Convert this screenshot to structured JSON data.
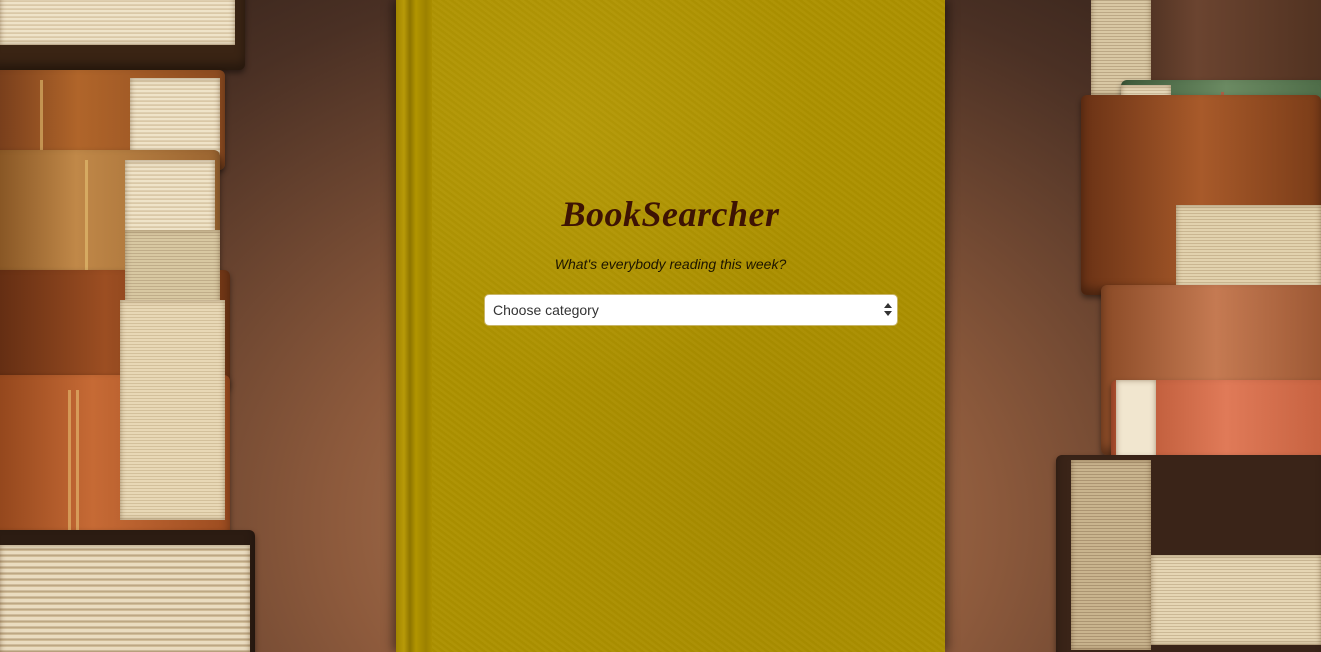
{
  "app": {
    "title": "BookSearcher",
    "subtitle": "What's everybody reading this week?"
  },
  "category_select": {
    "selected": "Choose category"
  },
  "colors": {
    "cover": "#ad9100",
    "title_text": "#3d1304",
    "select_bg": "#ffffff"
  },
  "icons": {
    "select_arrows": "updown-chevron-icon"
  }
}
